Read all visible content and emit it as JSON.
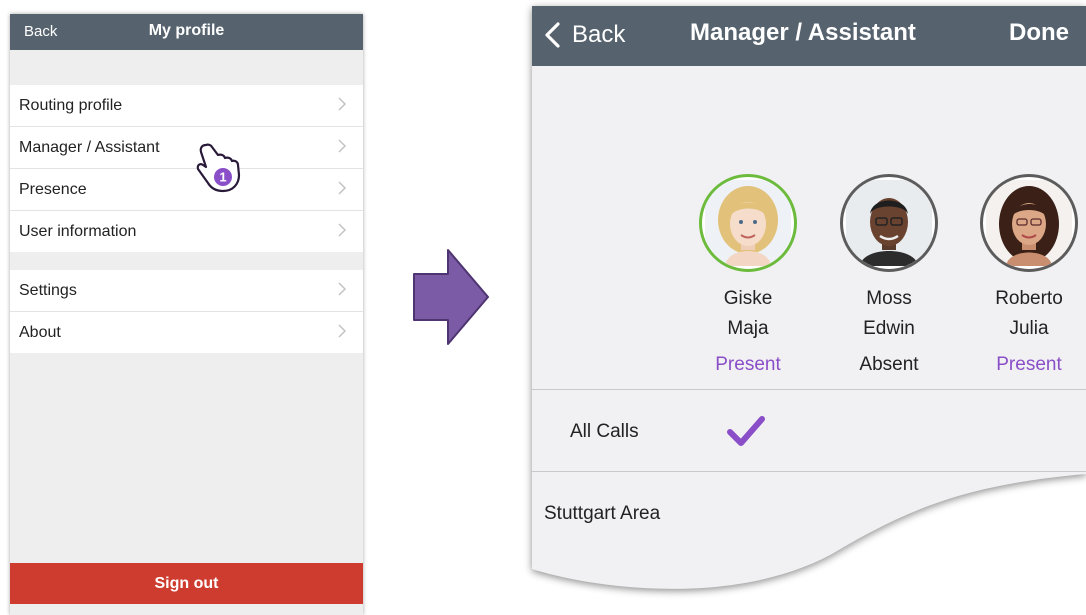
{
  "left_screen": {
    "header": {
      "back_label": "Back",
      "title": "My profile"
    },
    "group1": [
      {
        "label": "Routing profile"
      },
      {
        "label": "Manager / Assistant"
      },
      {
        "label": "Presence"
      },
      {
        "label": "User information"
      }
    ],
    "group2": [
      {
        "label": "Settings"
      },
      {
        "label": "About"
      }
    ],
    "cursor_step": "1",
    "sign_out_label": "Sign out",
    "colors": {
      "header": "#56636e",
      "sign_out": "#cd3c2f",
      "accent": "#8a4fc8"
    }
  },
  "right_screen": {
    "header": {
      "back_label": "Back",
      "title": "Manager / Assistant",
      "done_label": "Done"
    },
    "people": [
      {
        "first": "Giske",
        "last": "Maja",
        "status": "Present",
        "status_color": "#8a4fc8"
      },
      {
        "first": "Moss",
        "last": "Edwin",
        "status": "Absent",
        "status_color": "#222222"
      },
      {
        "first": "Roberto",
        "last": "Julia",
        "status": "Present",
        "status_color": "#8a4fc8"
      }
    ],
    "rows": [
      {
        "label": "All Calls",
        "checked": true
      },
      {
        "label": "Stuttgart Area",
        "checked": false
      }
    ]
  }
}
